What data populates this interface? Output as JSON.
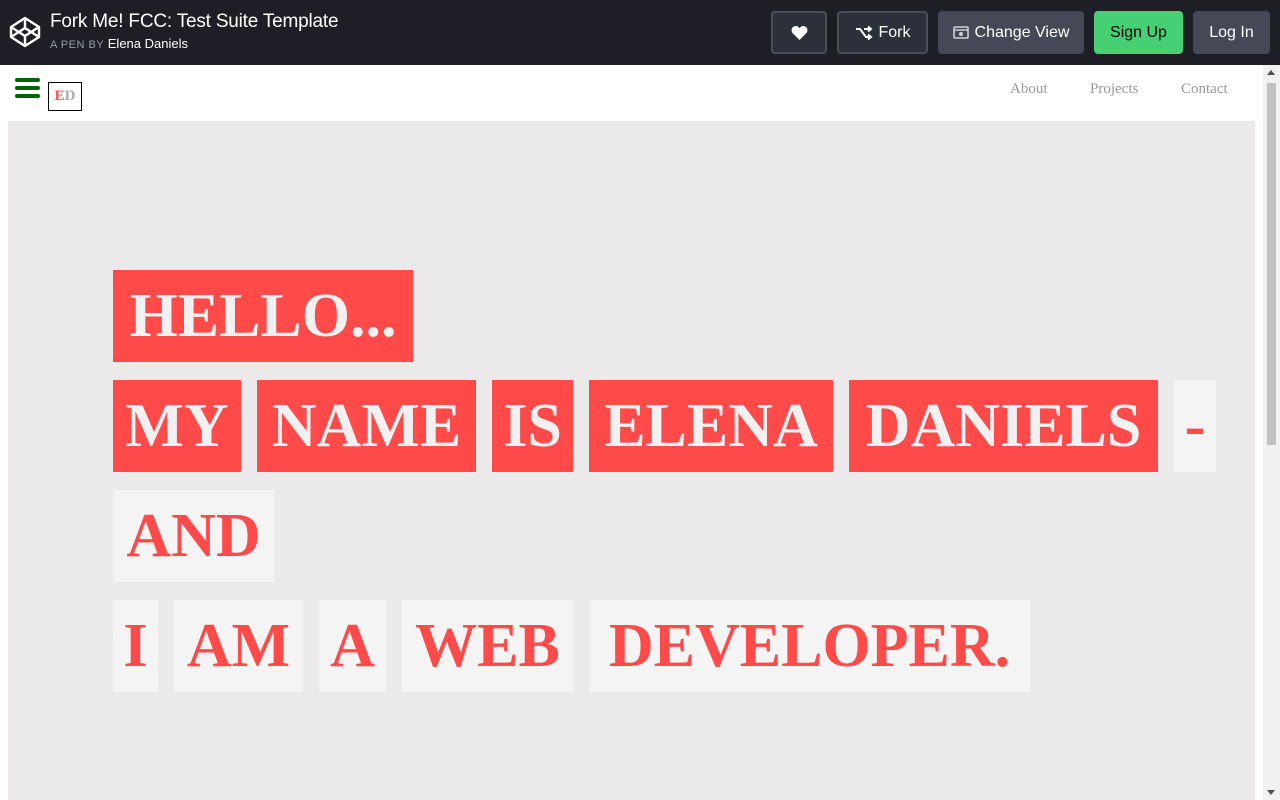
{
  "header": {
    "title": "Fork Me! FCC: Test Suite Template",
    "byline_prefix": "A PEN BY",
    "author": "Elena Daniels",
    "buttons": {
      "fork": "Fork",
      "change_view": "Change View",
      "sign_up": "Sign Up",
      "log_in": "Log In"
    }
  },
  "preview": {
    "logo": {
      "e": "E",
      "d": "D"
    },
    "nav": [
      "About",
      "Projects",
      "Contact"
    ],
    "hero": {
      "line1": [
        "HELLO..."
      ],
      "line2": [
        "MY",
        "NAME",
        "IS",
        "ELENA",
        "DANIELS",
        "-"
      ],
      "line3": [
        "AND"
      ],
      "line4": [
        "I",
        "AM",
        "A",
        "WEB",
        "DEVELOPER."
      ]
    }
  },
  "colors": {
    "accent_red": "#ff4a4a",
    "signup_green": "#47cf73",
    "hamburger_green": "#006400",
    "hero_background": "#ebe9ea"
  }
}
